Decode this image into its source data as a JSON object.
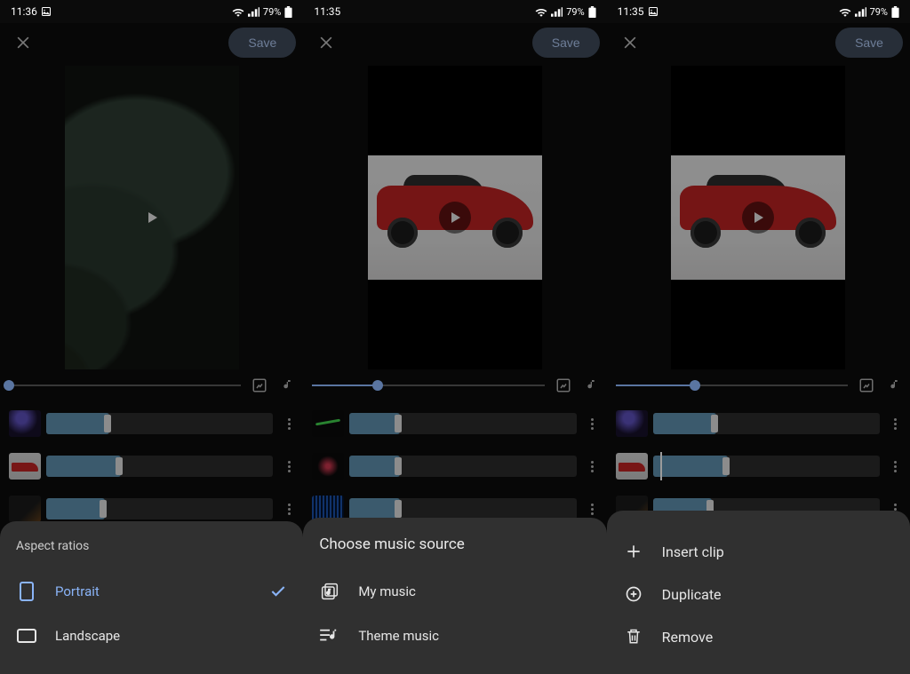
{
  "panels": {
    "p1": {
      "time": "11:36",
      "battery": "79%",
      "save": "Save",
      "slider_pct": 0,
      "sheet_title": "Aspect ratios",
      "opt_portrait": "Portrait",
      "opt_landscape": "Landscape"
    },
    "p2": {
      "time": "11:35",
      "battery": "79%",
      "save": "Save",
      "slider_pct": 28,
      "sheet_title": "Choose music source",
      "opt_mymusic": "My music",
      "opt_theme": "Theme music"
    },
    "p3": {
      "time": "11:35",
      "battery": "79%",
      "save": "Save",
      "slider_pct": 34,
      "opt_insert": "Insert clip",
      "opt_duplicate": "Duplicate",
      "opt_remove": "Remove"
    }
  }
}
